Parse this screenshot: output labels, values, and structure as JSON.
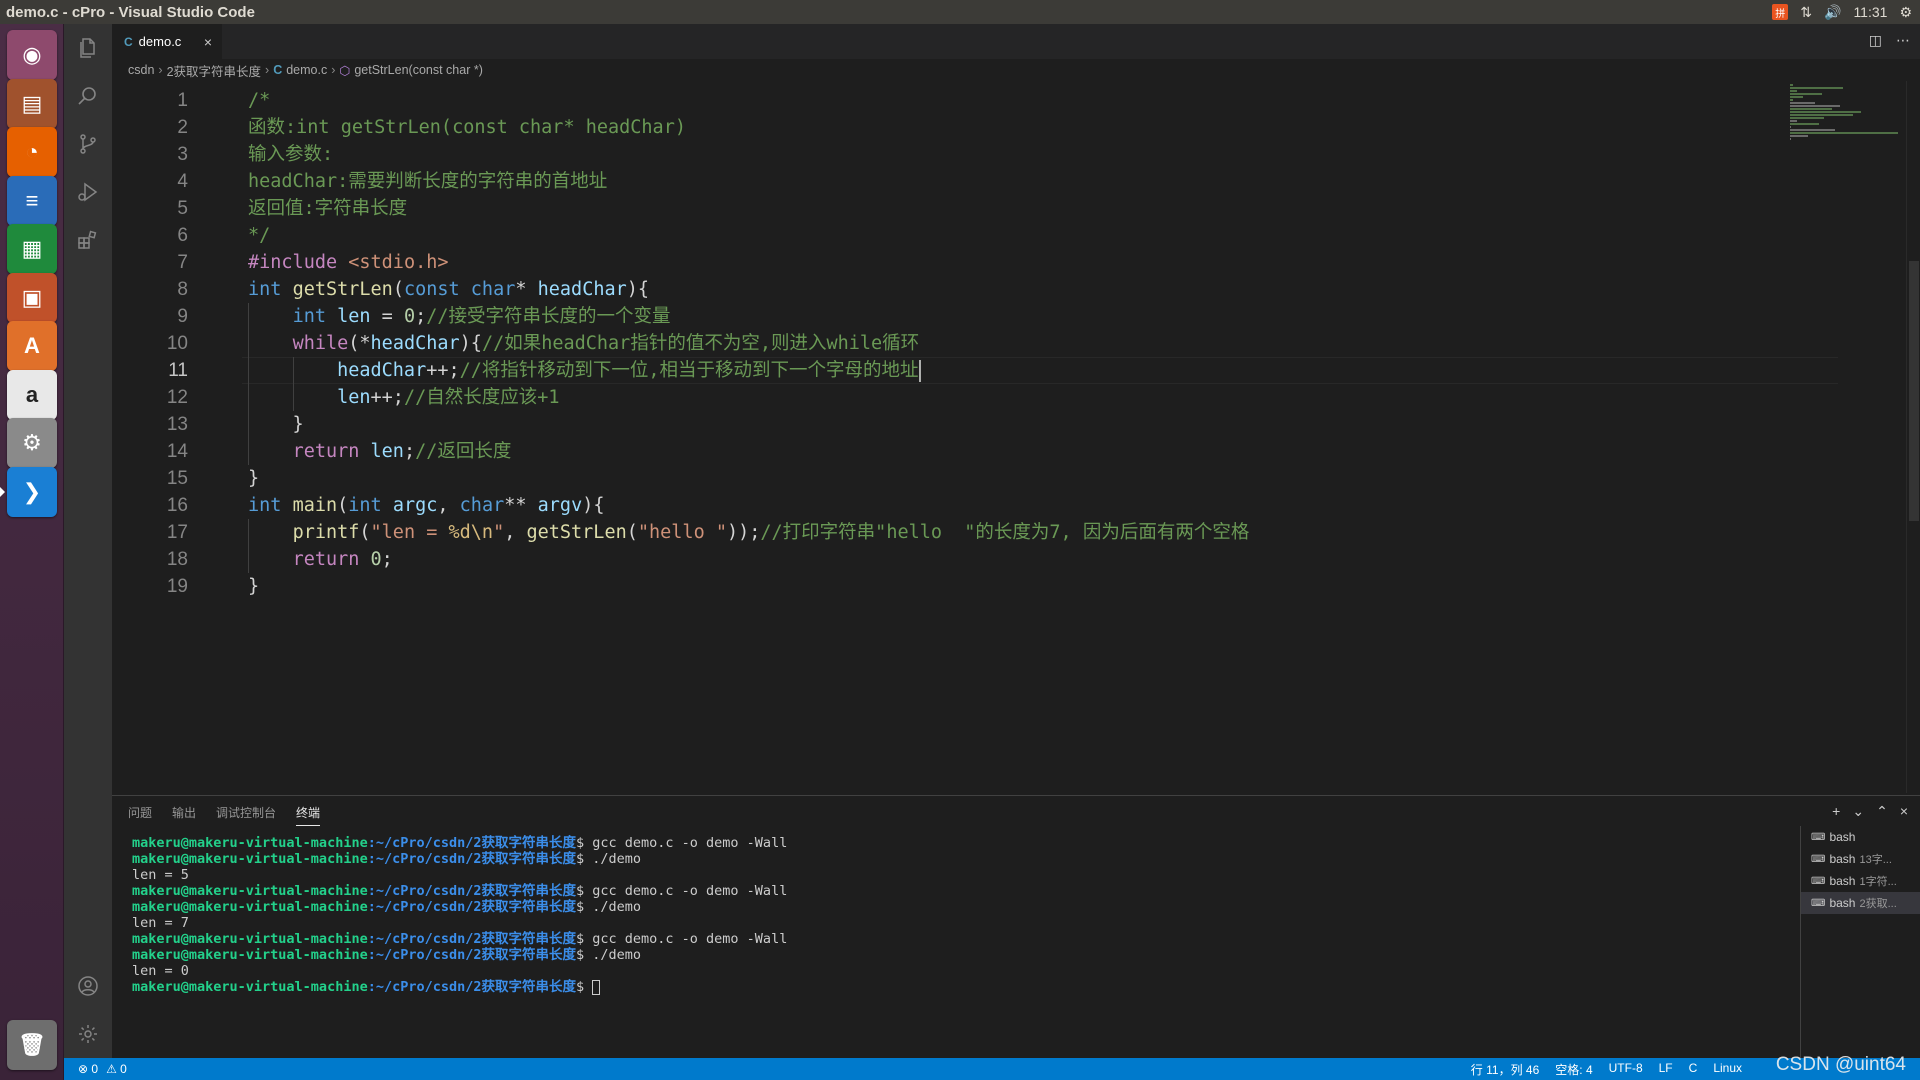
{
  "window": {
    "title": "demo.c - cPro - Visual Studio Code"
  },
  "tray": {
    "clock": "11:31",
    "ime_label": "拼"
  },
  "launcher": {
    "apps": [
      {
        "name": "ubuntu-dash",
        "glyph": "◉",
        "color": "#8e4a6d"
      },
      {
        "name": "files",
        "glyph": "▤",
        "color": "#a0522d"
      },
      {
        "name": "firefox",
        "glyph": "◔",
        "color": "#e66000"
      },
      {
        "name": "writer",
        "glyph": "≡",
        "color": "#2a6cb8"
      },
      {
        "name": "calc",
        "glyph": "▦",
        "color": "#1f8a3c"
      },
      {
        "name": "impress",
        "glyph": "▣",
        "color": "#c0512a"
      },
      {
        "name": "software-center",
        "glyph": "A",
        "color": "#e0702a"
      },
      {
        "name": "amazon",
        "glyph": "a",
        "color": "#e8e8e8"
      },
      {
        "name": "system-settings",
        "glyph": "⚙",
        "color": "#8a8a8a"
      },
      {
        "name": "vscode",
        "glyph": "❯",
        "color": "#1a7fd4"
      }
    ],
    "trash_glyph": "🗑"
  },
  "editor": {
    "tab": {
      "lang": "C",
      "name": "demo.c",
      "close": "×"
    },
    "breadcrumb": {
      "root": "csdn",
      "folder": "2获取字符串长度",
      "lang": "C",
      "file": "demo.c",
      "symbol": "getStrLen(const char *)"
    },
    "current_line": 11,
    "lines": [
      {
        "n": "1",
        "tokens": [
          {
            "t": "/*",
            "c": "cm"
          }
        ]
      },
      {
        "n": "2",
        "tokens": [
          {
            "t": "函数:int getStrLen(const char* headChar)",
            "c": "cm"
          }
        ]
      },
      {
        "n": "3",
        "tokens": [
          {
            "t": "输入参数:",
            "c": "cm"
          }
        ]
      },
      {
        "n": "4",
        "tokens": [
          {
            "t": "headChar:需要判断长度的字符串的首地址",
            "c": "cm"
          }
        ]
      },
      {
        "n": "5",
        "tokens": [
          {
            "t": "返回值:字符串长度",
            "c": "cm"
          }
        ]
      },
      {
        "n": "6",
        "tokens": [
          {
            "t": "*/",
            "c": "cm"
          }
        ]
      },
      {
        "n": "7",
        "tokens": [
          {
            "t": "#include ",
            "c": "pp"
          },
          {
            "t": "<stdio.h>",
            "c": "inc"
          }
        ]
      },
      {
        "n": "8",
        "tokens": [
          {
            "t": "int",
            "c": "kw"
          },
          {
            "t": " ",
            "c": ""
          },
          {
            "t": "getStrLen",
            "c": "fn"
          },
          {
            "t": "(",
            "c": ""
          },
          {
            "t": "const",
            "c": "kw"
          },
          {
            "t": " ",
            "c": ""
          },
          {
            "t": "char",
            "c": "kw"
          },
          {
            "t": "* ",
            "c": ""
          },
          {
            "t": "headChar",
            "c": "var"
          },
          {
            "t": "){",
            "c": ""
          }
        ]
      },
      {
        "n": "9",
        "tokens": [
          {
            "t": "    ",
            "c": ""
          },
          {
            "t": "int",
            "c": "kw"
          },
          {
            "t": " ",
            "c": ""
          },
          {
            "t": "len",
            "c": "var"
          },
          {
            "t": " = ",
            "c": ""
          },
          {
            "t": "0",
            "c": "num"
          },
          {
            "t": ";",
            "c": ""
          },
          {
            "t": "//接受字符串长度的一个变量",
            "c": "cm"
          }
        ]
      },
      {
        "n": "10",
        "tokens": [
          {
            "t": "    ",
            "c": ""
          },
          {
            "t": "while",
            "c": "ctl"
          },
          {
            "t": "(*",
            "c": ""
          },
          {
            "t": "headChar",
            "c": "var"
          },
          {
            "t": "){",
            "c": ""
          },
          {
            "t": "//如果headChar指针的值不为空,则进入while循环",
            "c": "cm"
          }
        ]
      },
      {
        "n": "11",
        "tokens": [
          {
            "t": "        ",
            "c": ""
          },
          {
            "t": "headChar",
            "c": "var"
          },
          {
            "t": "++;",
            "c": ""
          },
          {
            "t": "//将指针移动到下一位,相当于移动到下一个字母的地址",
            "c": "cm"
          }
        ]
      },
      {
        "n": "12",
        "tokens": [
          {
            "t": "        ",
            "c": ""
          },
          {
            "t": "len",
            "c": "var"
          },
          {
            "t": "++;",
            "c": ""
          },
          {
            "t": "//自然长度应该+1",
            "c": "cm"
          }
        ]
      },
      {
        "n": "13",
        "tokens": [
          {
            "t": "    }",
            "c": ""
          }
        ]
      },
      {
        "n": "14",
        "tokens": [
          {
            "t": "    ",
            "c": ""
          },
          {
            "t": "return",
            "c": "ctl"
          },
          {
            "t": " ",
            "c": ""
          },
          {
            "t": "len",
            "c": "var"
          },
          {
            "t": ";",
            "c": ""
          },
          {
            "t": "//返回长度",
            "c": "cm"
          }
        ]
      },
      {
        "n": "15",
        "tokens": [
          {
            "t": "}",
            "c": ""
          }
        ]
      },
      {
        "n": "16",
        "tokens": [
          {
            "t": "int",
            "c": "kw"
          },
          {
            "t": " ",
            "c": ""
          },
          {
            "t": "main",
            "c": "fn"
          },
          {
            "t": "(",
            "c": ""
          },
          {
            "t": "int",
            "c": "kw"
          },
          {
            "t": " ",
            "c": ""
          },
          {
            "t": "argc",
            "c": "var"
          },
          {
            "t": ", ",
            "c": ""
          },
          {
            "t": "char",
            "c": "kw"
          },
          {
            "t": "** ",
            "c": ""
          },
          {
            "t": "argv",
            "c": "var"
          },
          {
            "t": "){",
            "c": ""
          }
        ]
      },
      {
        "n": "17",
        "tokens": [
          {
            "t": "    ",
            "c": ""
          },
          {
            "t": "printf",
            "c": "fn"
          },
          {
            "t": "(",
            "c": ""
          },
          {
            "t": "\"len = ",
            "c": "str"
          },
          {
            "t": "%d\\n",
            "c": "esc"
          },
          {
            "t": "\"",
            "c": "str"
          },
          {
            "t": ", ",
            "c": ""
          },
          {
            "t": "getStrLen",
            "c": "fn"
          },
          {
            "t": "(",
            "c": ""
          },
          {
            "t": "\"hello \"",
            "c": "str"
          },
          {
            "t": "));",
            "c": ""
          },
          {
            "t": "//打印字符串\"hello  \"的长度为7, 因为后面有两个空格",
            "c": "cm"
          }
        ]
      },
      {
        "n": "18",
        "tokens": [
          {
            "t": "    ",
            "c": ""
          },
          {
            "t": "return",
            "c": "ctl"
          },
          {
            "t": " ",
            "c": ""
          },
          {
            "t": "0",
            "c": "num"
          },
          {
            "t": ";",
            "c": ""
          }
        ]
      },
      {
        "n": "19",
        "tokens": [
          {
            "t": "}",
            "c": ""
          }
        ]
      }
    ]
  },
  "panel": {
    "tabs": [
      "问题",
      "输出",
      "调试控制台",
      "终端"
    ],
    "active_tab": 3,
    "actions": [
      "+",
      "⌄",
      "⌃",
      "×"
    ],
    "terminal": {
      "user": "makeru@makeru-virtual-machine",
      "path": ":~/cPro/csdn/2获取字符串长度",
      "lines": [
        {
          "prompt": true,
          "cmd": "$ gcc demo.c -o demo -Wall"
        },
        {
          "prompt": true,
          "cmd": "$ ./demo"
        },
        {
          "prompt": false,
          "cmd": "len = 5"
        },
        {
          "prompt": true,
          "cmd": "$ gcc demo.c -o demo -Wall"
        },
        {
          "prompt": true,
          "cmd": "$ ./demo"
        },
        {
          "prompt": false,
          "cmd": "len = 7"
        },
        {
          "prompt": true,
          "cmd": "$ gcc demo.c -o demo -Wall"
        },
        {
          "prompt": true,
          "cmd": "$ ./demo"
        },
        {
          "prompt": false,
          "cmd": "len = 0"
        },
        {
          "prompt": true,
          "cmd": "$ ",
          "cursor": true
        }
      ]
    },
    "instances": [
      {
        "name": "bash",
        "sub": ""
      },
      {
        "name": "bash",
        "sub": "13字..."
      },
      {
        "name": "bash",
        "sub": "1字符..."
      },
      {
        "name": "bash",
        "sub": "2获取..."
      }
    ]
  },
  "statusbar": {
    "errors": "⊗ 0",
    "warnings": "⚠ 0",
    "position": "行 11，列 46",
    "spaces": "空格: 4",
    "encoding": "UTF-8",
    "eol": "LF",
    "lang": "C",
    "os": "Linux"
  },
  "watermark": "CSDN @uint64"
}
